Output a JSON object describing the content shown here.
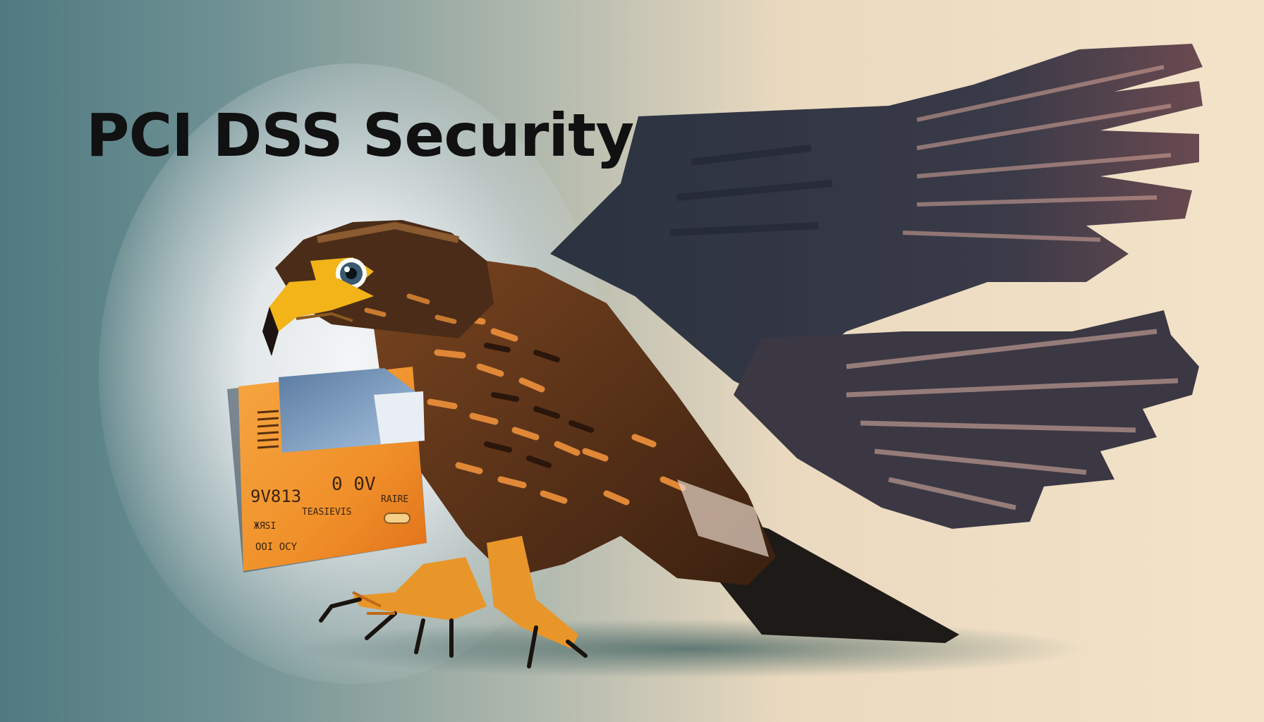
{
  "title": "PCI DSS Security",
  "card": {
    "line1": "9V813",
    "line1b": "0 0V",
    "line2a": "ЖЯЅI",
    "line2b": "TEASIEVIS",
    "line2c": "RAIRE",
    "line3": "OOI OCY"
  },
  "colors": {
    "background_left": "#4f7a80",
    "background_right": "#f3e3c9",
    "title": "#111111",
    "card_orange": "#f0902a",
    "hawk_brown": "#6b3a18",
    "wing_dark": "#2e3440",
    "beak_yellow": "#f2b418"
  }
}
